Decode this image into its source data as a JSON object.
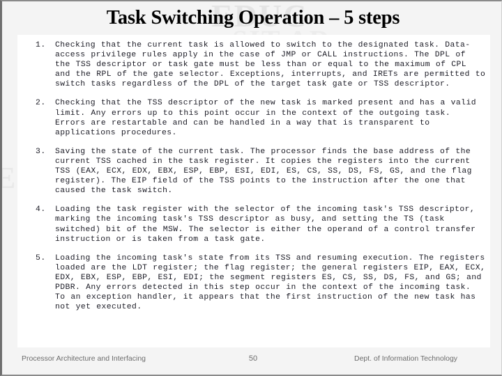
{
  "slide": {
    "title": "Task Switching Operation – 5 steps",
    "background_color": "#f4f4f4",
    "panel_color": "#ffffff",
    "text_color": "#1a1a24",
    "footer_text_color": "#6c6c6c",
    "watermark": {
      "line1": "EDUC",
      "line2": "SIT AD",
      "line3": "ECH"
    }
  },
  "steps": [
    {
      "number": "1.",
      "text": "Checking that the current task is allowed to switch to the designated task. Data-access privilege rules apply in the case of JMP or CALL instructions. The DPL of the TSS descriptor or task gate must be less than or equal to the maximum of CPL and the RPL of the gate selector. Exceptions, interrupts, and IRETs are permitted to switch tasks regardless of the DPL of the target task gate or TSS descriptor."
    },
    {
      "number": "2.",
      "text": "Checking that the TSS descriptor of the new task is marked present and has a valid limit. Any errors up to this point occur in the context of the outgoing task. Errors are restartable and can be handled in a way that is transparent to applications procedures."
    },
    {
      "number": "3.",
      "text": "Saving the state of the current task. The processor finds the base address of the current TSS cached in the task register. It copies the registers into the current TSS (EAX, ECX, EDX, EBX, ESP, EBP, ESI, EDI, ES, CS, SS, DS, FS, GS, and the flag register). The EIP field of the TSS points to the instruction after the one that caused the task switch."
    },
    {
      "number": "4.",
      "text": "Loading the task register with the selector of the incoming task's TSS descriptor, marking the incoming task's TSS descriptor as busy, and setting the TS (task switched) bit of the MSW. The selector is either the operand of a control transfer instruction or is taken from a task gate."
    },
    {
      "number": "5.",
      "text": "Loading the incoming task's state from its TSS and resuming execution. The registers loaded are the LDT register; the flag register; the general registers EIP, EAX, ECX, EDX, EBX, ESP, EBP, ESI, EDI; the segment registers ES, CS, SS, DS, FS, and GS; and PDBR. Any errors detected in this step occur in the context of the incoming task. To an exception handler, it appears that the first instruction of the new task has not yet executed."
    }
  ],
  "footer": {
    "left": "Processor Architecture and Interfacing",
    "page_number": "50",
    "right": "Dept. of Information Technology"
  }
}
